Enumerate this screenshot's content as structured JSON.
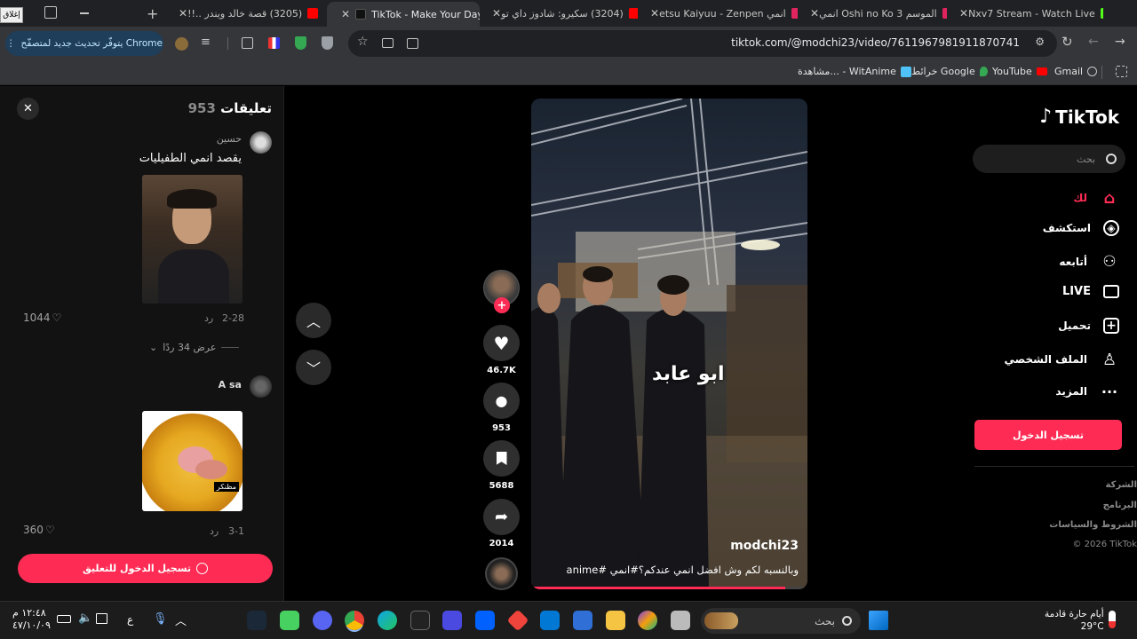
{
  "browser": {
    "close_window_label": "إغلاق",
    "tabs": [
      {
        "title": "(3205) قصة خالد ويندر ..!!",
        "favicon_color": "#ff0000"
      },
      {
        "title": "TikTok - Make Your Day",
        "favicon_color": "#000000"
      },
      {
        "title": "(3204) سكيرو: شادوز داي تو",
        "favicon_color": "#ff0000"
      },
      {
        "title": "etsu Kaiyuu - Zenpen انمي",
        "favicon_color": "#e0245e"
      },
      {
        "title": "انمي Oshi no Ko الموسم 3",
        "favicon_color": "#e0245e"
      },
      {
        "title": "Nxv7 Stream - Watch Live",
        "favicon_color": "#53fc18"
      }
    ],
    "update_label": "يتوفّر تحديث جديد لمتصفّح Chrome",
    "url": "tiktok.com/@modchi23/video/7611967981911870741",
    "bookmarks": [
      "Gmail",
      "YouTube",
      "خرائط Google",
      "مشاهدة... - WitAnime"
    ]
  },
  "comments": {
    "title": "تعليقات",
    "count": "953",
    "items": [
      {
        "user": "حسين",
        "text": "يقصد انمي الطفيليات",
        "date": "2-28",
        "reply": "رد",
        "likes": "1044"
      },
      {
        "user": "A sa",
        "text": "",
        "date": "3-1",
        "reply": "رد",
        "likes": "360",
        "sticker_label": "مظنكر"
      }
    ],
    "view_replies": "عرض 34 ردًا",
    "login_button": "تسجيل الدخول للتعليق"
  },
  "video": {
    "overlay_text": "ابو عابد",
    "username": "modchi23",
    "caption": "وبالنسبه لكم وش افضل انمي عندكم؟#انمي #anime",
    "progress": 0.92
  },
  "actions": {
    "likes": "46.7K",
    "comments": "953",
    "saves": "5688",
    "shares": "2014"
  },
  "sidebar": {
    "logo": "TikTok",
    "search_placeholder": "بحث",
    "nav": [
      {
        "label": "لك",
        "icon": "home-icon",
        "active": true
      },
      {
        "label": "استكشف",
        "icon": "compass-icon"
      },
      {
        "label": "أتابعه",
        "icon": "following-icon"
      },
      {
        "label": "LIVE",
        "icon": "live-icon"
      },
      {
        "label": "تحميل",
        "icon": "upload-icon"
      },
      {
        "label": "الملف الشخصي",
        "icon": "profile-icon"
      },
      {
        "label": "المزيد",
        "icon": "more-icon"
      }
    ],
    "login_button": "تسجيل الدخول",
    "footer": [
      "الشركة",
      "البرنامج",
      "الشروط والسياسات",
      "© 2026 TikTok"
    ]
  },
  "taskbar": {
    "search_placeholder": "بحث",
    "weather_temp": "29°C",
    "weather_text": "أيام حارة قادمة",
    "time": "١٢:٤٨ م",
    "date": "٤٧/١٠/٠٩",
    "lang": "ع"
  },
  "colors": {
    "accent": "#fe2c55",
    "tab_bg": "#202124",
    "toolbar_bg": "#35363a"
  }
}
